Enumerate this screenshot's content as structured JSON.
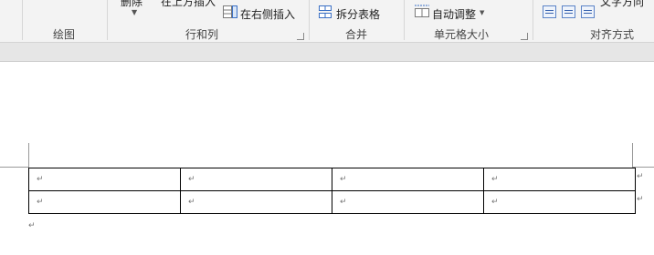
{
  "ribbon": {
    "groups": {
      "draw": "绘图",
      "rows_cols": "行和列",
      "merge": "合并",
      "cell_size": "单元格大小",
      "align": "对齐方式"
    },
    "buttons": {
      "delete": "删除",
      "insert_above": "在上方插入",
      "insert_right": "在右侧插入",
      "split_table": "拆分表格",
      "autofit": "自动调整",
      "text_direction": "文字方向"
    },
    "icons": {
      "dropdown": "chevron-down-icon",
      "launcher": "dialog-launcher-icon",
      "insert_right": "insert-right-icon",
      "split_table": "split-table-icon",
      "autofit": "autofit-icon"
    }
  },
  "document": {
    "table": {
      "rows": [
        [
          "↵",
          "↵",
          "↵",
          "↵"
        ],
        [
          "↵",
          "↵",
          "↵",
          "↵"
        ]
      ]
    },
    "paragraph_mark": "↵",
    "row_end_mark": "↵"
  }
}
